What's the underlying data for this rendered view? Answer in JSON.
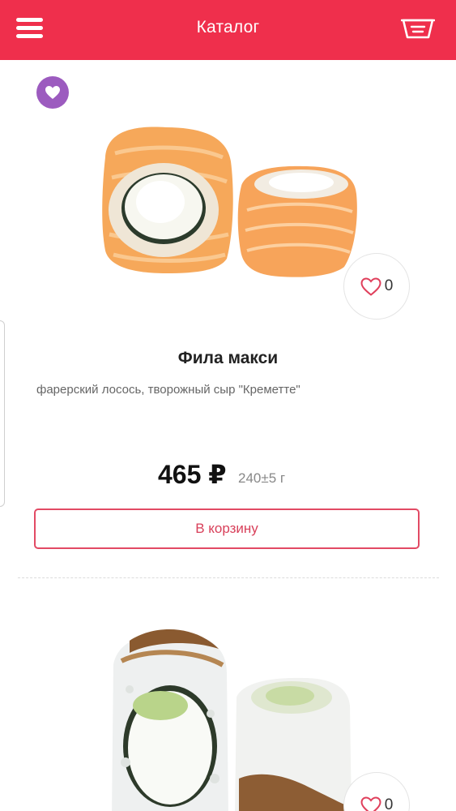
{
  "header": {
    "title": "Каталог",
    "menu_icon": "hamburger-menu-icon",
    "cart_icon": "basket-icon",
    "background_color": "#ef2f4c"
  },
  "products": [
    {
      "badge_icon": "heart-badge-icon",
      "badge_color": "#9c5bbf",
      "name": "Фила макси",
      "description": "фарерский лосось, творожный сыр \"Креметте\"",
      "price": "465 ₽",
      "weight": "240±5 г",
      "likes": "0",
      "cart_button_label": "В корзину"
    },
    {
      "likes": "0"
    }
  ],
  "accent_color": "#e24a64"
}
